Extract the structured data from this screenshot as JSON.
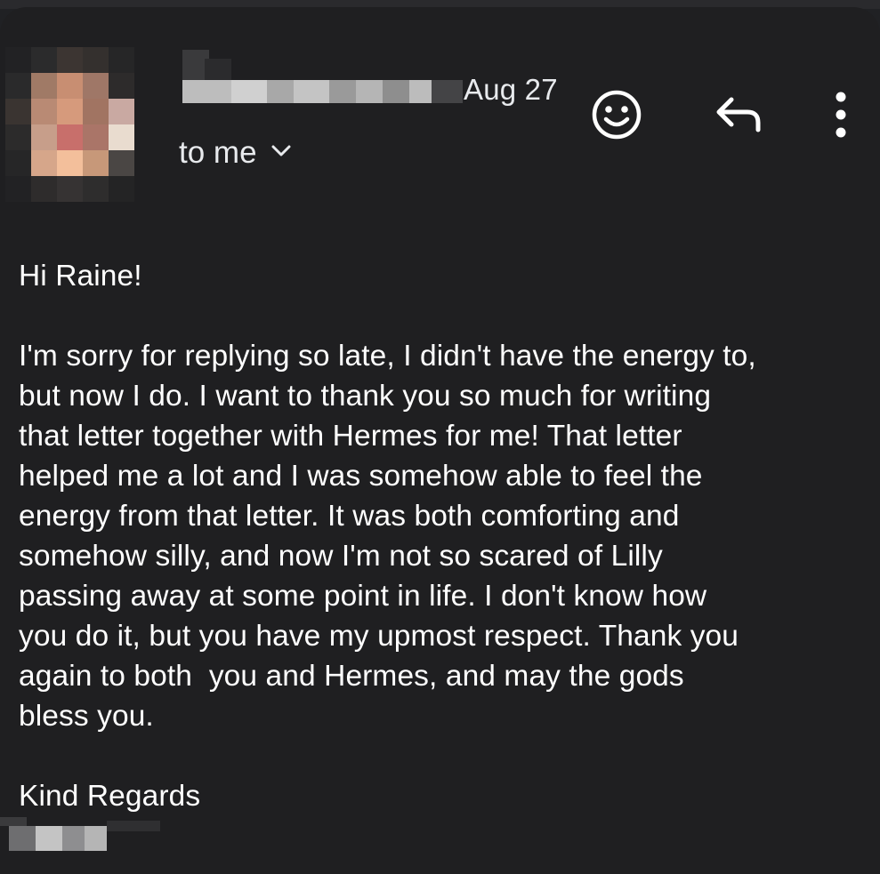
{
  "email": {
    "date": "Aug 27",
    "recipient_label": "to me",
    "greeting": "Hi Raine!",
    "body_lines": [
      "I'm sorry for replying so late, I didn't have the energy to,",
      "but now I do. I want to thank you so much for writing",
      "that letter together with Hermes for me! That letter",
      "helped me a lot and I was somehow able to feel the",
      "energy from that letter. It was both comforting and",
      "somehow silly, and now I'm not so scared of Lilly",
      "passing away at some point in life. I don't know how",
      "you do it, but you have my upmost respect. Thank you",
      "again to both  you and Hermes, and may the gods",
      "bless you."
    ],
    "signoff": "Kind Regards"
  },
  "icons": {
    "avatar": "sender-avatar-blurred",
    "sender_name": "sender-name-blurred",
    "expand": "chevron-down-icon",
    "emoji": "emoji-reaction-icon",
    "reply": "reply-icon",
    "more": "more-vert-icon",
    "signature": "signature-blurred"
  },
  "colors": {
    "background": "#1f1f21",
    "text": "#ffffff",
    "secondary_text": "#e8eaed"
  }
}
